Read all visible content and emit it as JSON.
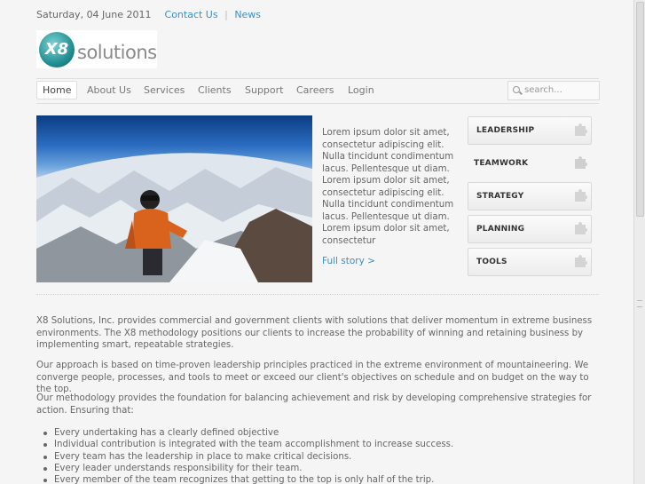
{
  "topbar": {
    "date": "Saturday, 04 June 2011",
    "links": [
      "Contact Us",
      "News"
    ],
    "separator": "|"
  },
  "logo": {
    "mark": "X8",
    "wordmark": "solutions"
  },
  "nav": {
    "items": [
      "Home",
      "About Us",
      "Services",
      "Clients",
      "Support",
      "Careers",
      "Login"
    ],
    "active": "Home"
  },
  "search": {
    "placeholder": "search..."
  },
  "story": {
    "text": "Lorem ipsum dolor sit amet, consectetur adipiscing elit. Nulla tincidunt condimentum lacus. Pellentesque ut diam. Lorem ipsum dolor sit amet, consectetur adipiscing elit. Nulla tincidunt condimentum lacus. Pellentesque ut diam. Lorem ipsum dolor sit amet, consectetur",
    "link": "Full story >"
  },
  "sidebar": {
    "buttons": [
      {
        "label": "LEADERSHIP",
        "style": "boxed"
      },
      {
        "label": "TEAMWORK",
        "style": "plain"
      },
      {
        "label": "STRATEGY",
        "style": "boxed"
      },
      {
        "label": "PLANNING",
        "style": "boxed"
      },
      {
        "label": "TOOLS",
        "style": "boxed"
      }
    ]
  },
  "content": {
    "paragraphs": [
      "X8 Solutions, Inc. provides commercial and government clients with solutions that deliver momentum in extreme business environments. The X8 methodology positions our clients to increase the probability of winning and retaining business by implementing smart,  repeatable strategies.",
      "Our approach is based on time-proven leadership principles practiced in the extreme environment of mountaineering.  We converge people, processes, and tools to meet or exceed our client's objectives on schedule and on budget on the way to the top.",
      "Our methodology provides the foundation for balancing achievement and risk by developing comprehensive strategies for action. Ensuring that:"
    ],
    "bullets": [
      "Every undertaking has a clearly defined objective",
      "Individual contribution is integrated with the team accomplishment to increase success.",
      "Every team has the leadership in place to make critical decisions.",
      "Every leader understands responsibility for their team.",
      "Every member of the team recognizes that getting to the top is only half of  the trip."
    ]
  },
  "colors": {
    "link": "#3d8fc8",
    "text": "#666666",
    "background": "#f5f5f5",
    "logo_teal": "#1d8a8f"
  },
  "icons": [
    "puzzle-icon",
    "search-icon"
  ]
}
